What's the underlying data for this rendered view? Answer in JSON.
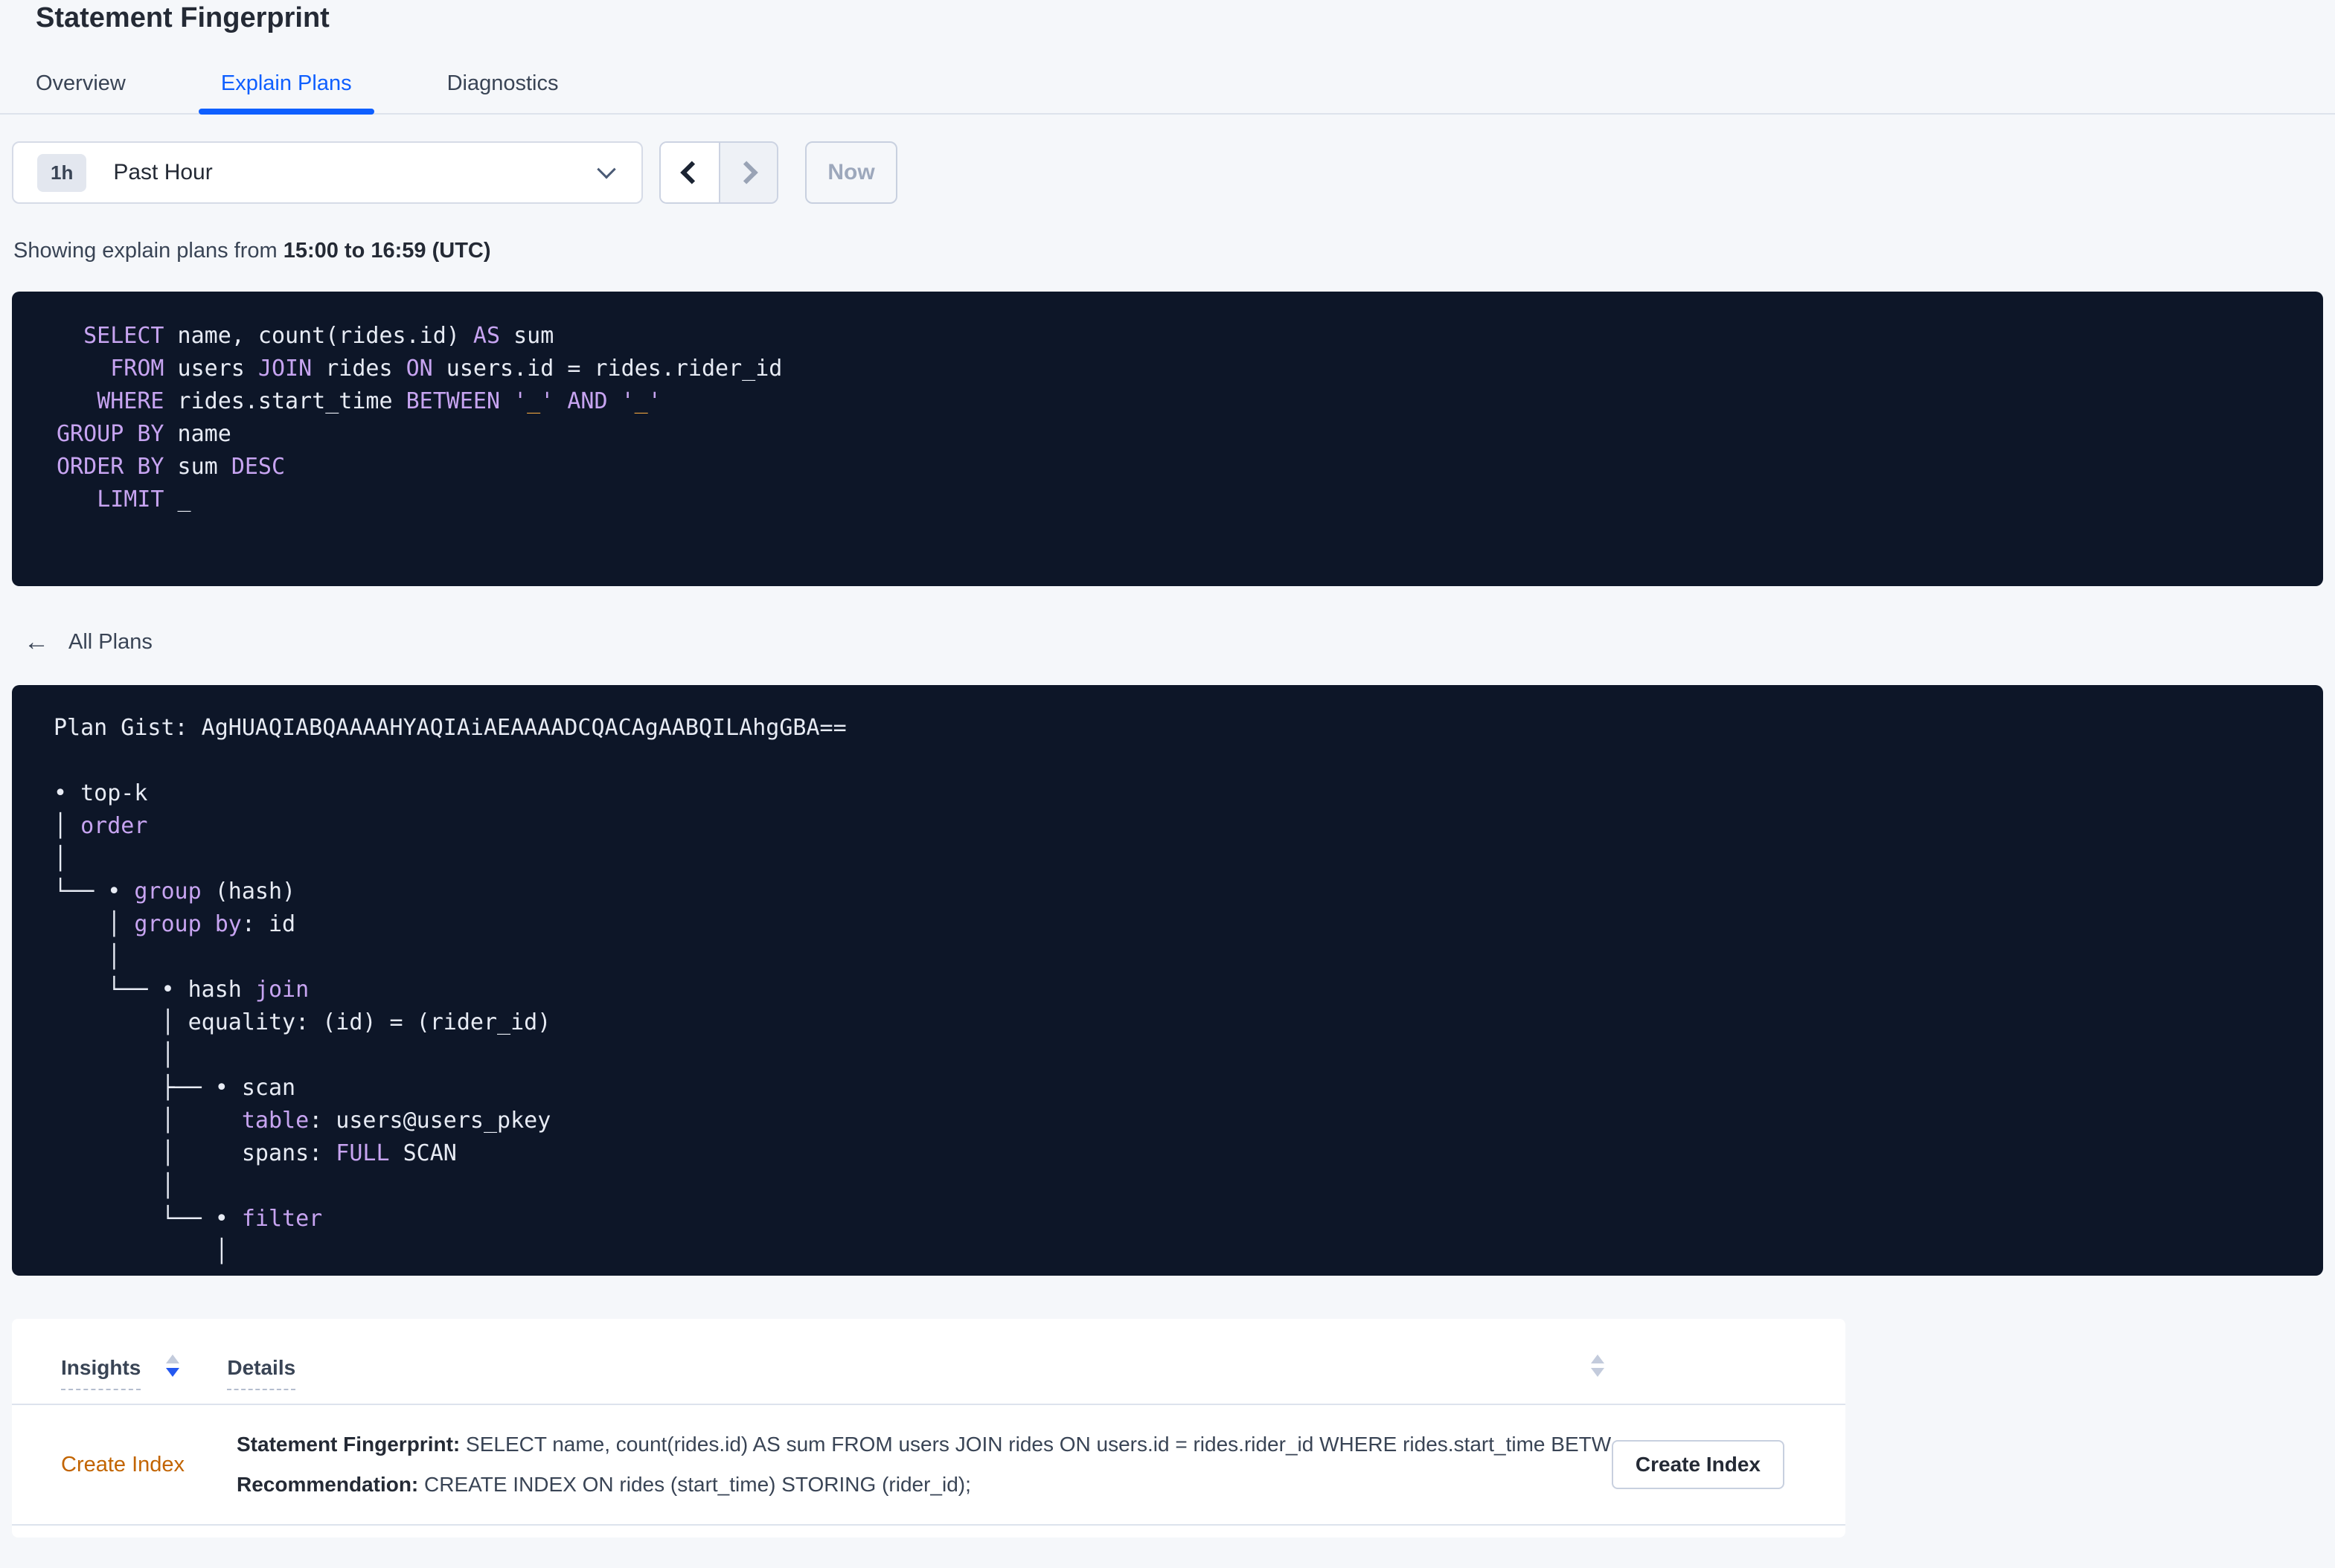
{
  "page": {
    "title": "Statement Fingerprint"
  },
  "tabs": [
    {
      "label": "Overview",
      "active": false
    },
    {
      "label": "Explain Plans",
      "active": true
    },
    {
      "label": "Diagnostics",
      "active": false
    }
  ],
  "time_picker": {
    "badge": "1h",
    "label": "Past Hour",
    "prev_enabled": true,
    "next_enabled": false,
    "now_label": "Now"
  },
  "status_line": {
    "prefix": "Showing explain plans from ",
    "range": "15:00 to 16:59 (UTC)"
  },
  "sql_block": {
    "lines": [
      [
        {
          "c": "t",
          "t": "  "
        },
        {
          "c": "k",
          "t": "SELECT"
        },
        {
          "c": "t",
          "t": " name, count(rides.id) "
        },
        {
          "c": "k",
          "t": "AS"
        },
        {
          "c": "t",
          "t": " sum"
        }
      ],
      [
        {
          "c": "t",
          "t": "    "
        },
        {
          "c": "k",
          "t": "FROM"
        },
        {
          "c": "t",
          "t": " users "
        },
        {
          "c": "k",
          "t": "JOIN"
        },
        {
          "c": "t",
          "t": " rides "
        },
        {
          "c": "k",
          "t": "ON"
        },
        {
          "c": "t",
          "t": " users.id = rides.rider_id"
        }
      ],
      [
        {
          "c": "t",
          "t": "   "
        },
        {
          "c": "k",
          "t": "WHERE"
        },
        {
          "c": "t",
          "t": " rides.start_time "
        },
        {
          "c": "k",
          "t": "BETWEEN"
        },
        {
          "c": "t",
          "t": " "
        },
        {
          "c": "k",
          "t": "'"
        },
        {
          "c": "o",
          "t": "_"
        },
        {
          "c": "k",
          "t": "'"
        },
        {
          "c": "t",
          "t": " "
        },
        {
          "c": "k",
          "t": "AND"
        },
        {
          "c": "t",
          "t": " "
        },
        {
          "c": "k",
          "t": "'"
        },
        {
          "c": "o",
          "t": "_"
        },
        {
          "c": "k",
          "t": "'"
        }
      ],
      [
        {
          "c": "k",
          "t": "GROUP BY"
        },
        {
          "c": "t",
          "t": " name"
        }
      ],
      [
        {
          "c": "k",
          "t": "ORDER BY"
        },
        {
          "c": "t",
          "t": " sum "
        },
        {
          "c": "k",
          "t": "DESC"
        }
      ],
      [
        {
          "c": "t",
          "t": "   "
        },
        {
          "c": "k",
          "t": "LIMIT"
        },
        {
          "c": "t",
          "t": " _"
        }
      ]
    ]
  },
  "back_link": {
    "label": "All Plans"
  },
  "plan_block": {
    "gist_label": "Plan Gist:",
    "gist": "AgHUAQIABQAAAAHYAQIAiAEAAAADCQACAgAABQILAhgGBA==",
    "lines": [
      [
        {
          "c": "t",
          "t": "Plan Gist: AgHUAQIABQAAAAHYAQIAiAEAAAADCQACAgAABQILAhgGBA=="
        }
      ],
      [],
      [
        {
          "c": "t",
          "t": "• top-k"
        }
      ],
      [
        {
          "c": "t",
          "t": "│ "
        },
        {
          "c": "k",
          "t": "order"
        }
      ],
      [
        {
          "c": "t",
          "t": "│"
        }
      ],
      [
        {
          "c": "t",
          "t": "└── • "
        },
        {
          "c": "k",
          "t": "group"
        },
        {
          "c": "t",
          "t": " (hash)"
        }
      ],
      [
        {
          "c": "t",
          "t": "    │ "
        },
        {
          "c": "k",
          "t": "group by"
        },
        {
          "c": "t",
          "t": ": id"
        }
      ],
      [
        {
          "c": "t",
          "t": "    │"
        }
      ],
      [
        {
          "c": "t",
          "t": "    └── • hash "
        },
        {
          "c": "k",
          "t": "join"
        }
      ],
      [
        {
          "c": "t",
          "t": "        │ equality: (id) = (rider_id)"
        }
      ],
      [
        {
          "c": "t",
          "t": "        │"
        }
      ],
      [
        {
          "c": "t",
          "t": "        ├── • scan"
        }
      ],
      [
        {
          "c": "t",
          "t": "        │     "
        },
        {
          "c": "k",
          "t": "table"
        },
        {
          "c": "t",
          "t": ": users@users_pkey"
        }
      ],
      [
        {
          "c": "t",
          "t": "        │     spans: "
        },
        {
          "c": "k",
          "t": "FULL"
        },
        {
          "c": "t",
          "t": " SCAN"
        }
      ],
      [
        {
          "c": "t",
          "t": "        │"
        }
      ],
      [
        {
          "c": "t",
          "t": "        └── • "
        },
        {
          "c": "k",
          "t": "filter"
        }
      ],
      [
        {
          "c": "t",
          "t": "            │"
        }
      ]
    ]
  },
  "insights_table": {
    "columns": [
      {
        "label": "Insights",
        "sort": "desc"
      },
      {
        "label": "Details",
        "sort": "none"
      }
    ],
    "rows": [
      {
        "insight": "Create Index",
        "fingerprint_label": "Statement Fingerprint:",
        "fingerprint_text": " SELECT name, count(rides.id) AS sum FROM users JOIN rides ON users.id = rides.rider_id WHERE rides.start_time BETWEEN '_…",
        "recommendation_label": "Recommendation:",
        "recommendation_text": " CREATE INDEX ON rides (start_time) STORING (rider_id);",
        "action_label": "Create Index"
      }
    ]
  },
  "colors": {
    "accent_blue": "#0e5fff",
    "sort_active_blue": "#2458f0",
    "link_orange": "#c26400",
    "code_background": "#0d1628",
    "code_keyword": "#c7a4f1",
    "code_text": "#e7ebf4",
    "code_literal": "#e9a23f",
    "page_background": "#f5f7fa"
  }
}
